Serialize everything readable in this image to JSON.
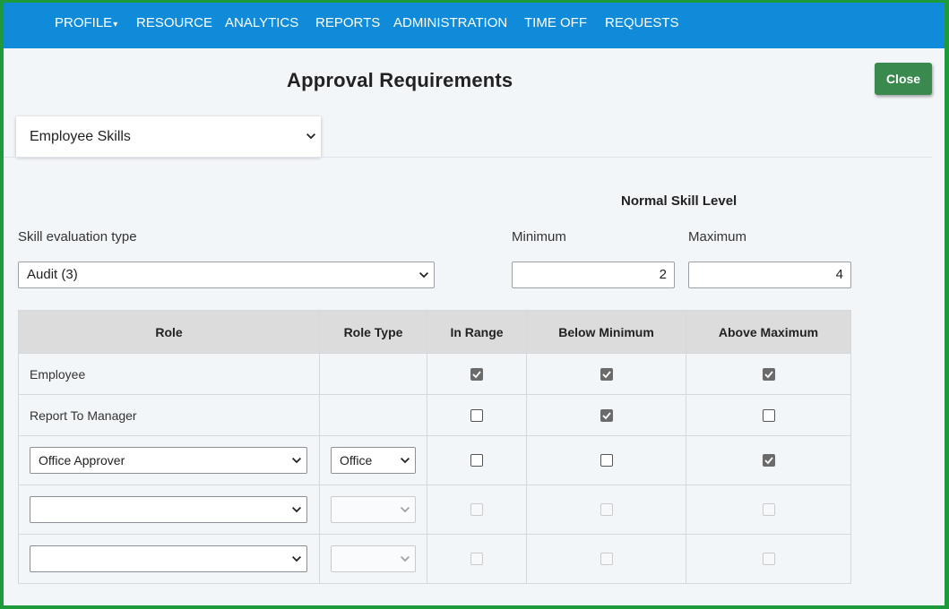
{
  "nav": {
    "items": [
      "PROFILE",
      "RESOURCE",
      "ANALYTICS",
      "REPORTS",
      "ADMINISTRATION",
      "TIME OFF",
      "REQUESTS"
    ],
    "profile_caret": "▾"
  },
  "page": {
    "title": "Approval Requirements",
    "close_label": "Close"
  },
  "category_select": {
    "value": "Employee Skills"
  },
  "skill": {
    "section_title": "Normal Skill Level",
    "eval_type_label": "Skill evaluation type",
    "eval_type_value": "Audit (3)",
    "min_label": "Minimum",
    "max_label": "Maximum",
    "min_value": "2",
    "max_value": "4"
  },
  "table": {
    "headers": [
      "Role",
      "Role Type",
      "In Range",
      "Below Minimum",
      "Above Maximum"
    ],
    "rows": [
      {
        "role": "Employee",
        "role_type": "",
        "in_range": true,
        "below": true,
        "above": true
      },
      {
        "role": "Report To Manager",
        "role_type": "",
        "in_range": false,
        "below": true,
        "above": false
      },
      {
        "role": "Office Approver",
        "role_type": "Office",
        "in_range": false,
        "below": false,
        "above": true
      },
      {
        "role": "",
        "role_type": "",
        "in_range": false,
        "below": false,
        "above": false
      },
      {
        "role": "",
        "role_type": "",
        "in_range": false,
        "below": false,
        "above": false
      }
    ]
  },
  "colors": {
    "navbar": "#0f8bd9",
    "close_button": "#3a8a4f",
    "frame_border": "#1f9a3a",
    "header_row": "#dcdcdc"
  }
}
